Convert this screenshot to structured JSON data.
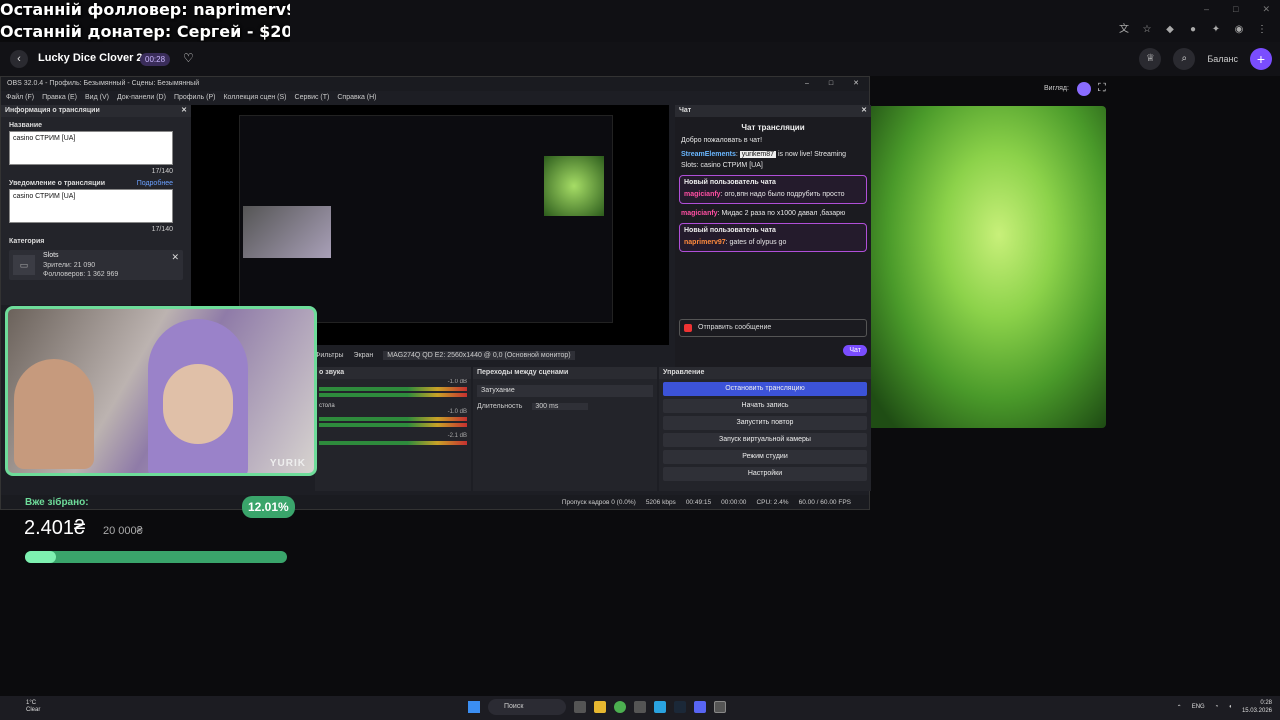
{
  "overlay": {
    "last_follower": "Останній фолловер: naprimerv97",
    "last_donator": "Останній донатер: Сергей - $20"
  },
  "casino": {
    "game_title": "Lucky Dice Clover 20",
    "timer": "00:28",
    "balance_label": "Баланс",
    "view_label": "Вигляд:"
  },
  "obs": {
    "title": "OBS 32.0.4 - Профиль: Безымянный - Сцены: Безымянный",
    "menu": [
      "Файл (F)",
      "Правка (E)",
      "Вид (V)",
      "Док-панели (D)",
      "Профиль (P)",
      "Коллекция сцен (S)",
      "Сервис (T)",
      "Справка (H)"
    ],
    "info_panel": {
      "title": "Информация о трансляции",
      "name_label": "Название",
      "name_value": "casino СТРИМ [UA]",
      "name_counter": "17/140",
      "notify_label": "Уведомление о трансляции",
      "notify_more": "Подробнее",
      "notify_value": "casino СТРИМ [UA]",
      "notify_counter": "17/140",
      "category_label": "Категория",
      "category_name": "Slots",
      "viewers": "Зрители: 21 090",
      "followers": "Фолловеров: 1 362 969"
    },
    "chat": {
      "dock_title": "Чат",
      "title": "Чат трансляции",
      "welcome": "Добро пожаловать в чат!",
      "bot_name": "StreamElements",
      "bot_highlight": "yurikem87",
      "bot_text": " is now live! Streaming Slots: casino СТРИМ [UA]",
      "new_user_label": "Новый пользователь чата",
      "msg1_user": "magicianfy",
      "msg1_text": ": ого,впн надо было подрубить просто",
      "msg2_user": "magicianfy",
      "msg2_text": ": Мидас 2 раза по x1000 давал ,базарю",
      "msg3_user": "naprimerv97",
      "msg3_text": ": gates of olypus go",
      "input_placeholder": "Отправить сообщение",
      "send_label": "Чат"
    },
    "source_toolbar": {
      "filters": "Фильтры",
      "screen_label": "Экран",
      "screen_value": "MAG274Q QD E2: 2560x1440 @ 0,0 (Основной монитор)"
    },
    "mixer": {
      "title": "о звука",
      "label2": "стола",
      "db1": "-1.0 dB",
      "db2": "-1.0 dB",
      "db3": "-2.1 dB"
    },
    "transitions": {
      "title": "Переходы между сценами",
      "type": "Затухание",
      "duration_label": "Длительность",
      "duration_value": "300 ms"
    },
    "controls": {
      "title": "Управление",
      "buttons": [
        "Остановить трансляцию",
        "Начать запись",
        "Запустить повтор",
        "Запуск виртуальной камеры",
        "Режим студии",
        "Настройки"
      ]
    },
    "status": {
      "dropped": "Пропуск кадров 0 (0.0%)",
      "bitrate": "5206 kbps",
      "live_time": "00:49:15",
      "rec_time": "00:00:00",
      "cpu": "CPU: 2.4%",
      "fps": "60.00 / 60.00 FPS"
    }
  },
  "camera": {
    "name": "YURIK"
  },
  "donation": {
    "label": "Вже зібрано:",
    "percent": "12.01%",
    "percent_value": 0.1201,
    "amount": "2.401₴",
    "goal": "20 000₴"
  },
  "taskbar": {
    "weather_temp": "1°C",
    "weather_text": "Clear",
    "search": "Поиск",
    "lang": "ENG",
    "time": "0:28",
    "date": "15.03.2026"
  },
  "colors": {
    "accent": "#7a4dff",
    "obs_primary": "#3c53d8",
    "donation_green": "#3aa56b"
  }
}
